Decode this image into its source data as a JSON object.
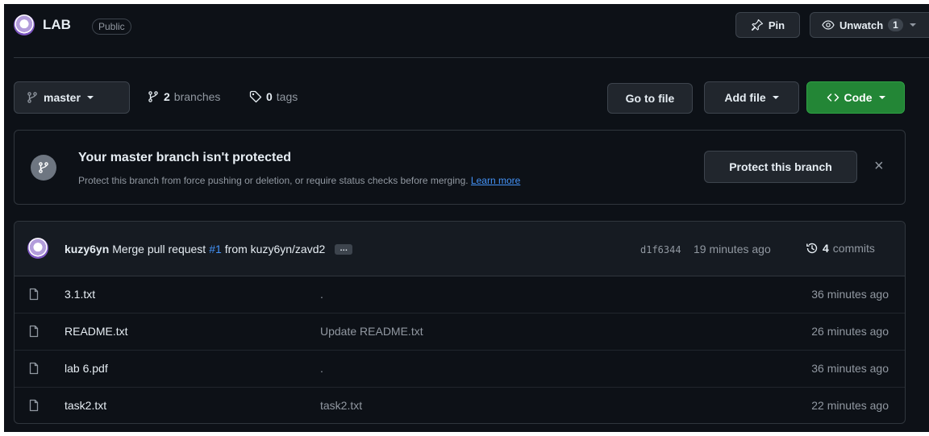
{
  "repo": {
    "name": "LAB",
    "visibility": "Public"
  },
  "actions": {
    "pin_label": "Pin",
    "unwatch_label": "Unwatch",
    "unwatch_count": "1"
  },
  "toolbar": {
    "branch": "master",
    "branches_count": "2",
    "branches_label": "branches",
    "tags_count": "0",
    "tags_label": "tags",
    "go_to_file": "Go to file",
    "add_file": "Add file",
    "code": "Code"
  },
  "banner": {
    "title": "Your master branch isn't protected",
    "description": "Protect this branch from force pushing or deletion, or require status checks before merging.",
    "learn_more": "Learn more",
    "protect_button": "Protect this branch",
    "close": "×"
  },
  "latest_commit": {
    "author": "kuzy6yn",
    "message_prefix": "Merge pull request",
    "pr_ref": "#1",
    "message_suffix": "from kuzy6yn/zavd2",
    "ellipsis": "…",
    "sha": "d1f6344",
    "time": "19 minutes ago",
    "commits_count": "4",
    "commits_label": "commits"
  },
  "files": [
    {
      "name": "3.1.txt",
      "message": ".",
      "time": "36 minutes ago"
    },
    {
      "name": "README.txt",
      "message": "Update README.txt",
      "time": "26 minutes ago"
    },
    {
      "name": "lab 6.pdf",
      "message": ".",
      "time": "36 minutes ago"
    },
    {
      "name": "task2.txt",
      "message": "task2.txt",
      "time": "22 minutes ago"
    }
  ],
  "icons": {
    "pin": "pin-icon",
    "eye": "eye-icon",
    "branch": "git-branch-icon",
    "tag": "tag-icon",
    "code": "code-icon",
    "history": "history-icon",
    "file": "file-icon"
  },
  "colors": {
    "background": "#0d1117",
    "border": "#30363d",
    "accent_green": "#238636",
    "link_blue": "#4493f8",
    "muted": "#9198a1"
  }
}
